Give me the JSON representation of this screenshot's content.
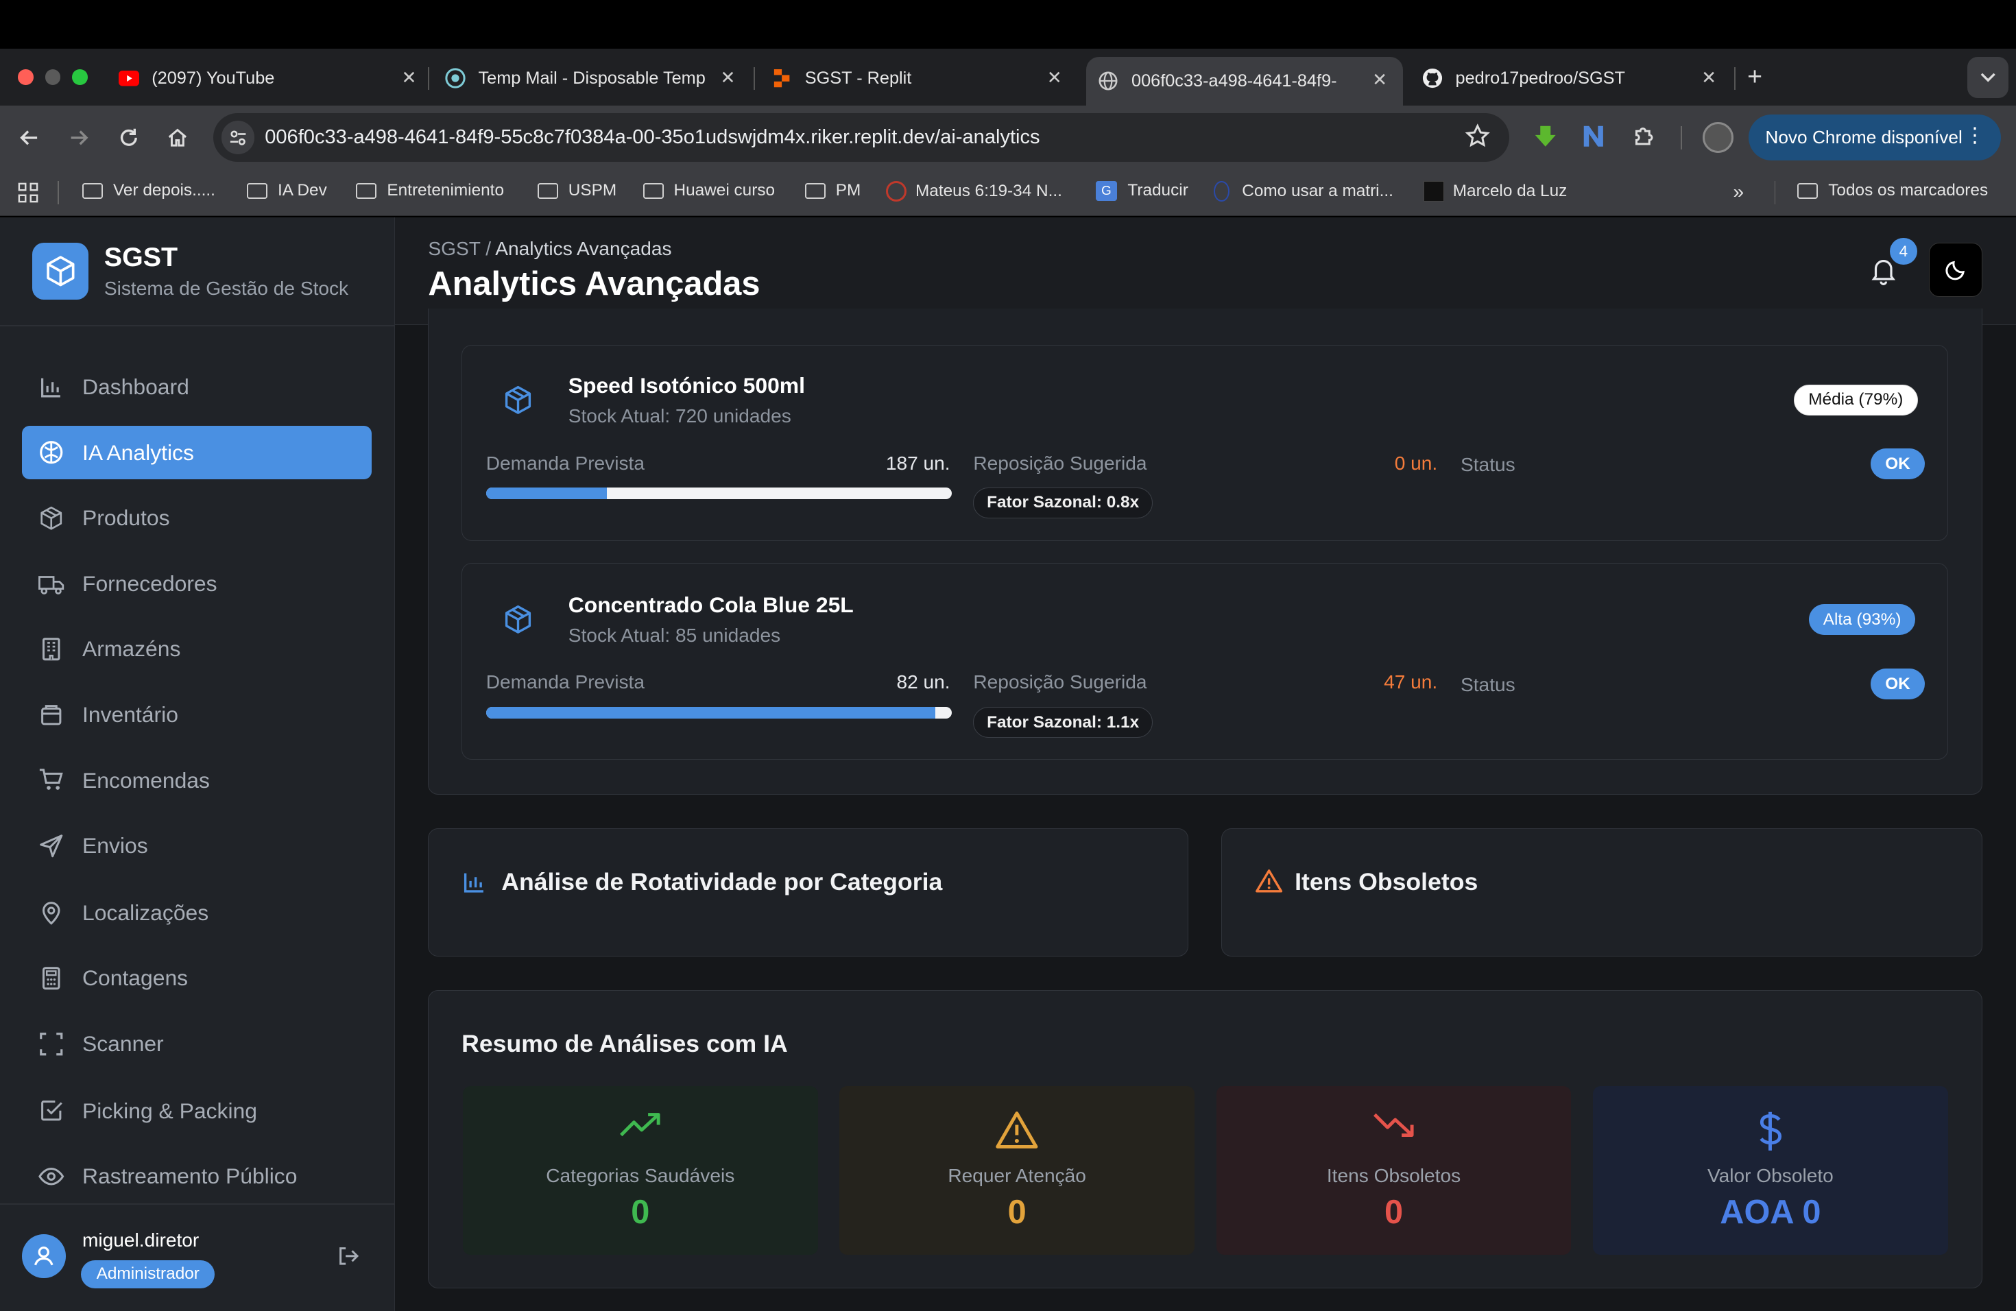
{
  "browser": {
    "tabs": [
      {
        "title": "(2097) YouTube",
        "icon": "youtube-icon"
      },
      {
        "title": "Temp Mail - Disposable Temp",
        "icon": "tempmail-icon"
      },
      {
        "title": "SGST - Replit",
        "icon": "replit-icon"
      },
      {
        "title": "006f0c33-a498-4641-84f9-",
        "icon": "globe-icon",
        "active": true
      },
      {
        "title": "pedro17pedroo/SGST",
        "icon": "github-icon"
      }
    ],
    "url": "006f0c33-a498-4641-84f9-55c8c7f0384a-00-35o1udswjdm4x.riker.replit.dev/ai-analytics",
    "update_label": "Novo Chrome disponível",
    "bookmarks": [
      "Ver depois.....",
      "IA Dev",
      "Entretenimiento",
      "USPM",
      "Huawei curso",
      "PM",
      "Mateus 6:19-34 N...",
      "Traducir",
      "Como usar a matri...",
      "Marcelo da Luz"
    ],
    "all_bookmarks": "Todos os marcadores"
  },
  "app": {
    "brand": {
      "title": "SGST",
      "subtitle": "Sistema de Gestão de Stock"
    },
    "nav": [
      {
        "label": "Dashboard",
        "icon": "bar-chart-icon"
      },
      {
        "label": "IA Analytics",
        "icon": "brain-icon",
        "active": true
      },
      {
        "label": "Produtos",
        "icon": "package-icon"
      },
      {
        "label": "Fornecedores",
        "icon": "truck-icon"
      },
      {
        "label": "Armazéns",
        "icon": "building-icon"
      },
      {
        "label": "Inventário",
        "icon": "archive-icon"
      },
      {
        "label": "Encomendas",
        "icon": "cart-icon"
      },
      {
        "label": "Envios",
        "icon": "send-icon"
      },
      {
        "label": "Localizações",
        "icon": "map-pin-icon"
      },
      {
        "label": "Contagens",
        "icon": "calculator-icon"
      },
      {
        "label": "Scanner",
        "icon": "scan-icon"
      },
      {
        "label": "Picking & Packing",
        "icon": "check-square-icon"
      },
      {
        "label": "Rastreamento Público",
        "icon": "eye-icon"
      }
    ],
    "user": {
      "name": "miguel.diretor",
      "role": "Administrador"
    }
  },
  "header": {
    "breadcrumb_root": "SGST",
    "breadcrumb_sep": "/",
    "breadcrumb_current": "Analytics Avançadas",
    "title": "Analytics Avançadas",
    "notifications": "4"
  },
  "forecasts": [
    {
      "name": "Speed Isotónico 500ml",
      "stock": "Stock Atual: 720 unidades",
      "confidence": "Média (79%)",
      "demand_label": "Demanda Prevista",
      "demand": "187 un.",
      "demand_fraction": 0.26,
      "reorder_label": "Reposição Sugerida",
      "reorder": "0 un.",
      "seasonal": "Fator Sazonal: 0.8x",
      "status_label": "Status",
      "status": "OK"
    },
    {
      "name": "Concentrado Cola Blue 25L",
      "stock": "Stock Atual: 85 unidades",
      "confidence": "Alta (93%)",
      "demand_label": "Demanda Prevista",
      "demand": "82 un.",
      "demand_fraction": 0.965,
      "reorder_label": "Reposição Sugerida",
      "reorder": "47 un.",
      "seasonal": "Fator Sazonal: 1.1x",
      "status_label": "Status",
      "status": "OK"
    }
  ],
  "sections": {
    "rotation": "Análise de Rotatividade por Categoria",
    "obsolete": "Itens Obsoletos",
    "summary": "Resumo de Análises com IA"
  },
  "summary_stats": [
    {
      "label": "Categorias Saudáveis",
      "value": "0",
      "color": "#3fb950",
      "icon": "trending-up-icon"
    },
    {
      "label": "Requer Atenção",
      "value": "0",
      "color": "#e3a33b",
      "icon": "alert-triangle-icon"
    },
    {
      "label": "Itens Obsoletos",
      "value": "0",
      "color": "#e5534b",
      "icon": "trending-down-icon"
    },
    {
      "label": "Valor Obsoleto",
      "value": "AOA 0",
      "color": "#4a7fe8",
      "icon": "dollar-icon"
    }
  ]
}
